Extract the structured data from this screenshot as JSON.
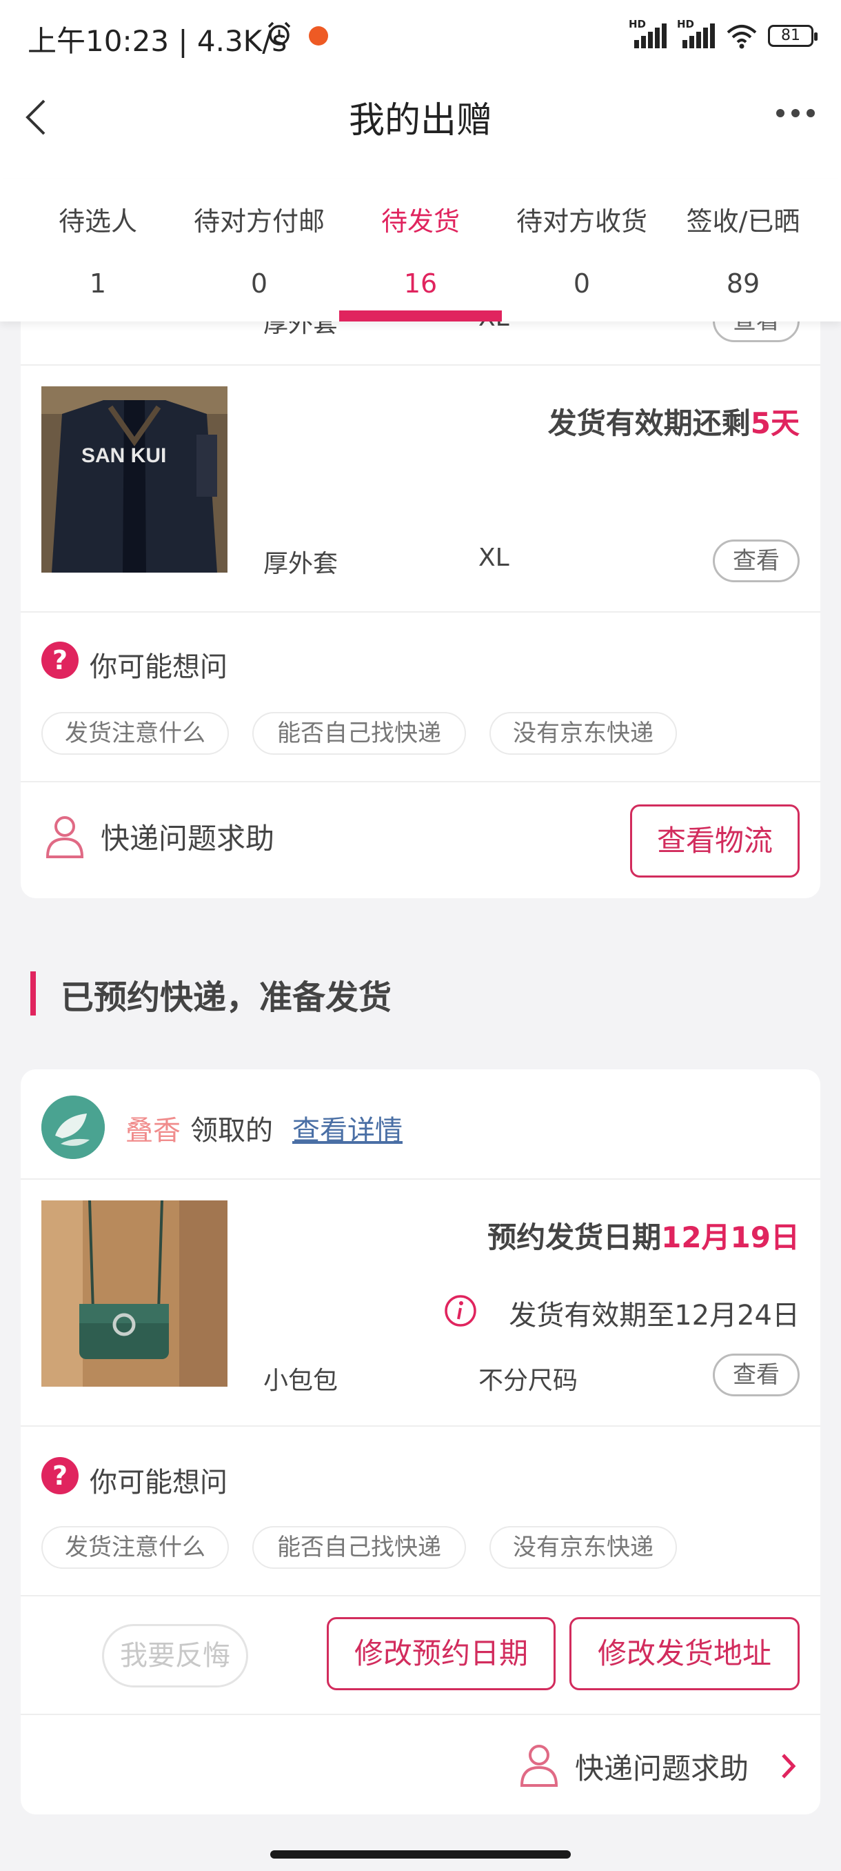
{
  "status_bar": {
    "time": "上午10:23 | 4.3K/s",
    "battery": "81",
    "signal1": "HD",
    "signal2": "HD"
  },
  "nav": {
    "title": "我的出赠"
  },
  "tabs": [
    {
      "label": "待选人",
      "count": "1"
    },
    {
      "label": "待对方付邮",
      "count": "0"
    },
    {
      "label": "待发货",
      "count": "16"
    },
    {
      "label": "待对方收货",
      "count": "0"
    },
    {
      "label": "签收/已晒",
      "count": "89"
    }
  ],
  "partial_item": {
    "name": "厚外套",
    "size": "XL",
    "view": "查看"
  },
  "card1": {
    "deadline_prefix": "发货有效期还剩",
    "deadline_value": "5天",
    "item_name": "厚外套",
    "item_size": "XL",
    "view_label": "查看",
    "thumb_text": "SAN KUI",
    "faq_title": "你可能想问",
    "chips": [
      "发货注意什么",
      "能否自己找快递",
      "没有京东快递"
    ],
    "help_text": "快递问题求助",
    "logistics_button": "查看物流"
  },
  "section": {
    "title": "已预约快递，准备发货"
  },
  "card2": {
    "user_name": "叠香",
    "claimed_text": "领取的",
    "details_link": "查看详情",
    "appointment_prefix": "预约发货日期",
    "appointment_date": "12月19日",
    "validity_text": "发货有效期至12月24日",
    "item_name": "小包包",
    "item_size": "不分尺码",
    "view_label": "查看",
    "faq_title": "你可能想问",
    "chips": [
      "发货注意什么",
      "能否自己找快递",
      "没有京东快递"
    ],
    "regret_button": "我要反悔",
    "change_date_button": "修改预约日期",
    "change_address_button": "修改发货地址",
    "help_text": "快递问题求助"
  },
  "colors": {
    "accent": "#e0245e",
    "accent_dark": "#d22c5d",
    "link": "#4a6fa5",
    "name_pink": "#f08c8c"
  }
}
